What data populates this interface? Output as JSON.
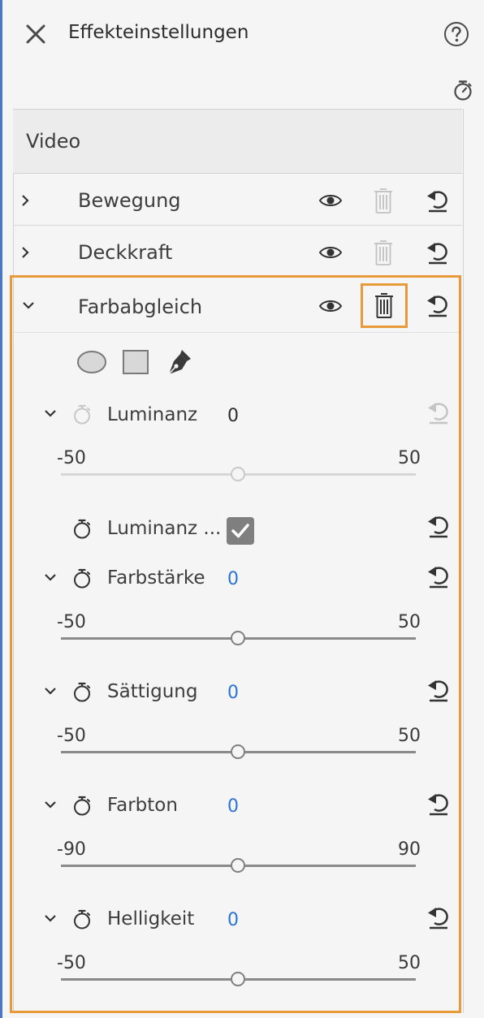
{
  "header": {
    "title": "Effekteinstellungen",
    "close_icon": "close-icon",
    "help_icon": "help-icon",
    "stopwatch_icon": "stopwatch-icon"
  },
  "section": {
    "title": "Video"
  },
  "effects": [
    {
      "label": "Bewegung",
      "expanded": false
    },
    {
      "label": "Deckkraft",
      "expanded": false
    },
    {
      "label": "Farbabgleich",
      "expanded": true
    }
  ],
  "mask_tools": [
    "ellipse-mask-icon",
    "rectangle-mask-icon",
    "pen-mask-icon"
  ],
  "params": {
    "luminanz": {
      "label": "Luminanz",
      "value": "0",
      "min": "-50",
      "max": "50",
      "level": 0.5
    },
    "luminanz_check": {
      "label": "Luminanz ...",
      "checked": true
    },
    "farbstaerke": {
      "label": "Farbstärke",
      "value": "0",
      "min": "-50",
      "max": "50",
      "level": 0.5
    },
    "saettigung": {
      "label": "Sättigung",
      "value": "0",
      "min": "-50",
      "max": "50",
      "level": 0.5
    },
    "farbton": {
      "label": "Farbton",
      "value": "0",
      "min": "-90",
      "max": "90",
      "level": 0.5
    },
    "helligkeit": {
      "label": "Helligkeit",
      "value": "0",
      "min": "-50",
      "max": "50",
      "level": 0.5
    }
  },
  "colors": {
    "highlight": "#e8993a",
    "value_blue": "#2a74d5",
    "panel_bg": "#f5f5f5"
  }
}
